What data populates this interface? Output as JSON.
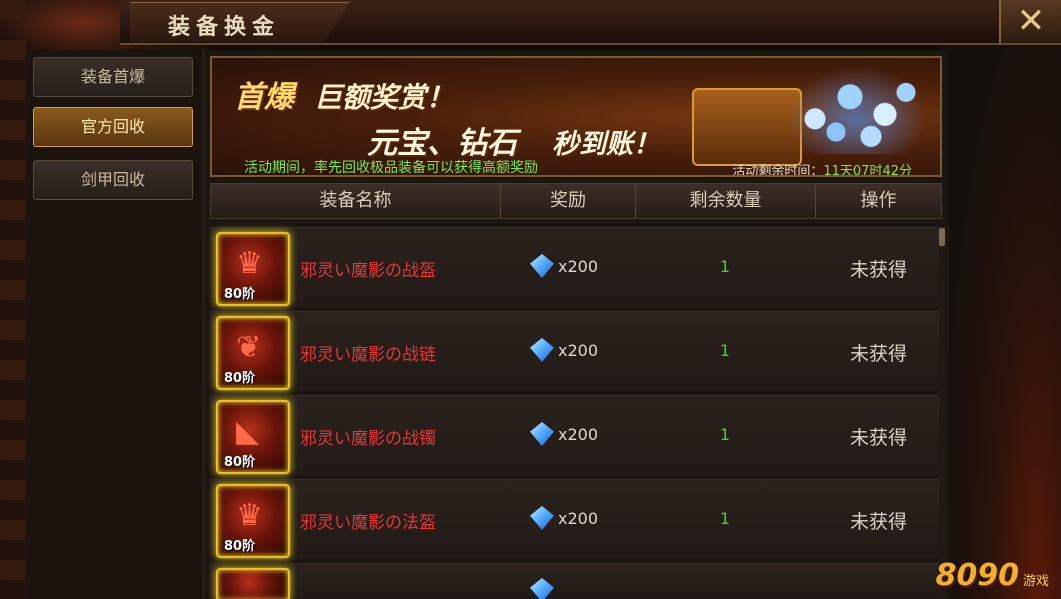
{
  "window": {
    "title": "装备换金",
    "close_glyph": "✕"
  },
  "sidebar": {
    "items": [
      {
        "label": "装备首爆",
        "active": false
      },
      {
        "label": "官方回收",
        "active": true
      },
      {
        "label": "剑甲回收",
        "active": false
      }
    ]
  },
  "banner": {
    "headline_a": "首爆",
    "headline_b": "巨额奖赏！",
    "subline_a": "元宝、钻石",
    "subline_b": "秒到账！",
    "description": "活动期间，率先回收极品装备可以获得高额奖励",
    "timer_label": "活动剩余时间：",
    "timer_value": "11天07时42分"
  },
  "table": {
    "headers": [
      "装备名称",
      "奖励",
      "剩余数量",
      "操作"
    ],
    "rows": [
      {
        "tier": "80阶",
        "name": "邪灵い魔影の战盔",
        "reward": "x200",
        "remaining": "1",
        "status": "未获得",
        "glyph": "♛"
      },
      {
        "tier": "80阶",
        "name": "邪灵い魔影の战链",
        "reward": "x200",
        "remaining": "1",
        "status": "未获得",
        "glyph": "❦"
      },
      {
        "tier": "80阶",
        "name": "邪灵い魔影の战镯",
        "reward": "x200",
        "remaining": "1",
        "status": "未获得",
        "glyph": "◣"
      },
      {
        "tier": "80阶",
        "name": "邪灵い魔影の法盔",
        "reward": "x200",
        "remaining": "1",
        "status": "未获得",
        "glyph": "♛"
      }
    ]
  },
  "watermark": {
    "brand": "8090",
    "sub": "游戏"
  },
  "colors": {
    "item_name": "#e8343a",
    "remaining": "#3fd42c",
    "accent_gold": "#e8c21a",
    "promo_green": "#7ce84a"
  }
}
